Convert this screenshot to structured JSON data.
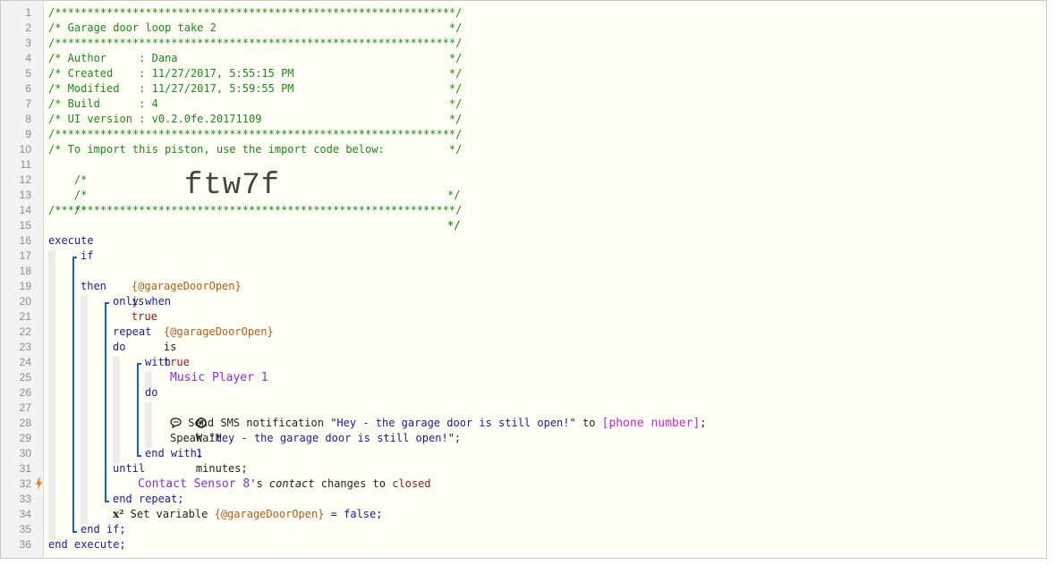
{
  "line_numbers": [
    "1",
    "2",
    "3",
    "4",
    "5",
    "6",
    "7",
    "8",
    "9",
    "10",
    "11",
    "12",
    "13",
    "14",
    "15",
    "16",
    "17",
    "18",
    "19",
    "20",
    "21",
    "22",
    "23",
    "24",
    "25",
    "26",
    "27",
    "28",
    "29",
    "30",
    "31",
    "32",
    "33",
    "34",
    "35",
    "36"
  ],
  "header": {
    "border_line": "/**************************************************************/",
    "title_line": "/* Garage door loop take 2                                    */",
    "author_line": "/* Author     : Dana                                          */",
    "created_line": "/* Created    : 11/27/2017, 5:55:15 PM                        */",
    "modified_line": "/* Modified   : 11/27/2017, 5:59:55 PM                        */",
    "build_line": "/* Build      : 4                                             */",
    "ui_line": "/* UI version : v0.2.0fe.20171109                             */",
    "import_line": "/* To import this piston, use the import code below:          */",
    "blank_comment_left": "/*",
    "blank_comment_right": "*/",
    "import_code": "ftw7f"
  },
  "code": {
    "execute": "execute",
    "if": "if",
    "var_garage": "{@garageDoorOpen}",
    "is": "is",
    "true": "true",
    "then": "then",
    "only_when": "only when",
    "repeat": "repeat",
    "do": "do",
    "with": "with",
    "music_player": "Music Player 1",
    "wait_prefix": "Wait",
    "wait_num": "1",
    "wait_suffix": "minutes;",
    "sms_prefix": "Send SMS notification",
    "quote_open": "\"",
    "message": "Hey - the garage door is still open!",
    "sms_to": "\" to",
    "phone": "[phone number]",
    "semicolon": ";",
    "speak_prefix": "Speak",
    "speak_close": "\";",
    "end_with": "end with;",
    "until": "until",
    "contact_sensor": "Contact Sensor 8",
    "possessive": "'s",
    "contact": "contact",
    "changes": "changes",
    "to": "to",
    "closed": "closed",
    "end_repeat": "end repeat;",
    "set_variable": "Set variable",
    "equals": "=",
    "false": "false",
    "end_if": "end if;",
    "end_execute": "end execute;"
  },
  "icons": {
    "clock": "clock-icon",
    "sms": "speech-bubble-icon",
    "variable": "x-squared-icon",
    "trigger": "lightning-bolt-icon"
  },
  "colors": {
    "comment": "#1a8a1a",
    "keyword": "#1a1aa8",
    "variable": "#b65c1a",
    "value": "#8b1a1a",
    "device": "#8a2be2",
    "phone": "#d020d0",
    "bracket": "#1b5fc9",
    "trigger": "#f07a22"
  }
}
